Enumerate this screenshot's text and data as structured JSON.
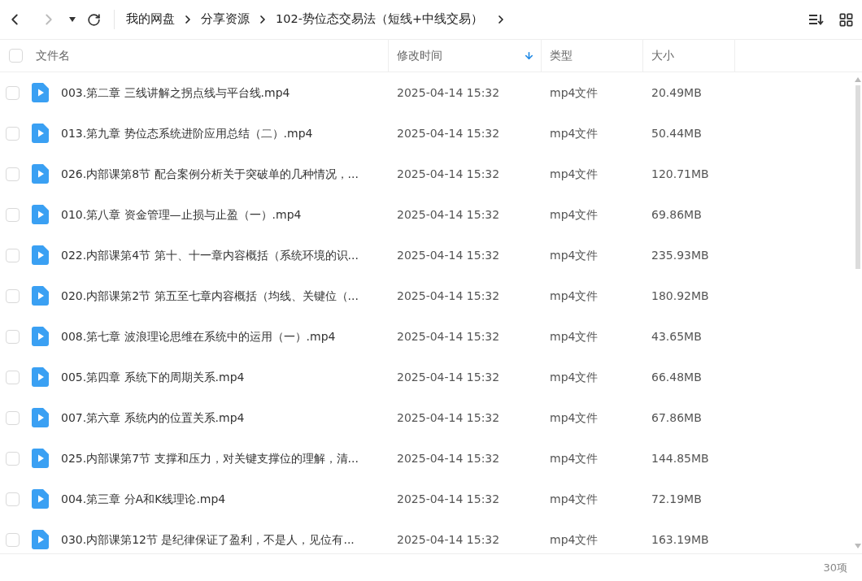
{
  "breadcrumb": [
    "我的网盘",
    "分享资源",
    "102-势位态交易法（短线+中线交易）"
  ],
  "table": {
    "select_all": {
      "checked": false
    },
    "columns": [
      {
        "label": "文件名",
        "sorted": false
      },
      {
        "label": "修改时间",
        "sorted": true
      },
      {
        "label": "类型",
        "sorted": false
      },
      {
        "label": "大小",
        "sorted": false
      }
    ],
    "rows": [
      {
        "name": "003.第二章   三线讲解之拐点线与平台线.mp4",
        "modified": "2025-04-14 15:32",
        "type": "mp4文件",
        "size": "20.49MB",
        "checked": false
      },
      {
        "name": "013.第九章    势位态系统进阶应用总结（二）.mp4",
        "modified": "2025-04-14 15:32",
        "type": "mp4文件",
        "size": "50.44MB",
        "checked": false
      },
      {
        "name": "026.内部课第8节 配合案例分析关于突破单的几种情况，...",
        "modified": "2025-04-14 15:32",
        "type": "mp4文件",
        "size": "120.71MB",
        "checked": false
      },
      {
        "name": "010.第八章   资金管理—止损与止盈（一）.mp4",
        "modified": "2025-04-14 15:32",
        "type": "mp4文件",
        "size": "69.86MB",
        "checked": false
      },
      {
        "name": "022.内部课第4节 第十、十一章内容概括（系统环境的识...",
        "modified": "2025-04-14 15:32",
        "type": "mp4文件",
        "size": "235.93MB",
        "checked": false
      },
      {
        "name": "020.内部课第2节 第五至七章内容概括（均线、关键位（...",
        "modified": "2025-04-14 15:32",
        "type": "mp4文件",
        "size": "180.92MB",
        "checked": false
      },
      {
        "name": "008.第七章  波浪理论思维在系统中的运用（一）.mp4",
        "modified": "2025-04-14 15:32",
        "type": "mp4文件",
        "size": "43.65MB",
        "checked": false
      },
      {
        "name": "005.第四章   系统下的周期关系.mp4",
        "modified": "2025-04-14 15:32",
        "type": "mp4文件",
        "size": "66.48MB",
        "checked": false
      },
      {
        "name": "007.第六章  系统内的位置关系.mp4",
        "modified": "2025-04-14 15:32",
        "type": "mp4文件",
        "size": "67.86MB",
        "checked": false
      },
      {
        "name": "025.内部课第7节 支撑和压力，对关键支撑位的理解，清...",
        "modified": "2025-04-14 15:32",
        "type": "mp4文件",
        "size": "144.85MB",
        "checked": false
      },
      {
        "name": "004.第三章   分A和K线理论.mp4",
        "modified": "2025-04-14 15:32",
        "type": "mp4文件",
        "size": "72.19MB",
        "checked": false
      },
      {
        "name": "030.内部课第12节 是纪律保证了盈利，不是人，见位有...",
        "modified": "2025-04-14 15:32",
        "type": "mp4文件",
        "size": "163.19MB",
        "checked": false
      }
    ]
  },
  "status_bar": {
    "count": "30项"
  }
}
